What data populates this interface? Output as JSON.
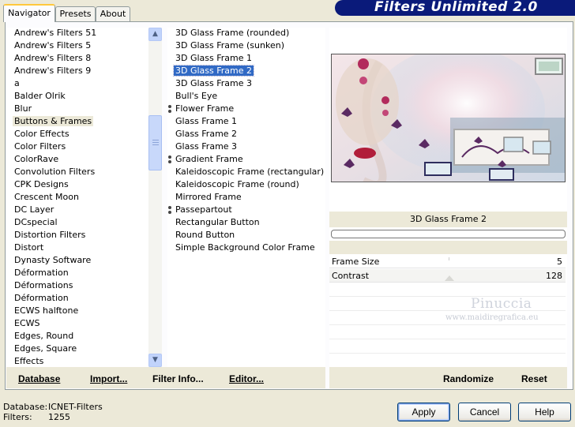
{
  "tabs": [
    {
      "label": "Navigator"
    },
    {
      "label": "Presets"
    },
    {
      "label": "About"
    }
  ],
  "brand": {
    "title": "Filters Unlimited 2.0",
    "color": "#0a1a7a"
  },
  "categories": {
    "selected_index": 8,
    "items": [
      "Andrew's Filters 51",
      "Andrew's Filters 5",
      "Andrew's Filters 8",
      "Andrew's Filters 9",
      "a",
      "Balder Olrik",
      "Blur",
      "Buttons & Frames",
      "Color Effects",
      "Color Filters",
      "ColorRave",
      "Convolution Filters",
      "CPK Designs",
      "Crescent Moon",
      "DC Layer",
      "DCspecial",
      "Distortion Filters",
      "Distort",
      "Dynasty Software",
      "Déformation",
      "Déformations",
      "Déformation",
      "ECWS halftone",
      "ECWS",
      "Edges, Round",
      "Edges, Square",
      "Effects"
    ]
  },
  "filters": {
    "items": [
      {
        "label": "3D Glass Frame (rounded)",
        "group": false,
        "selected": false
      },
      {
        "label": "3D Glass Frame (sunken)",
        "group": false,
        "selected": false
      },
      {
        "label": "3D Glass Frame 1",
        "group": false,
        "selected": false
      },
      {
        "label": "3D Glass Frame 2",
        "group": false,
        "selected": true
      },
      {
        "label": "3D Glass Frame 3",
        "group": false,
        "selected": false
      },
      {
        "label": "Bull's Eye",
        "group": false,
        "selected": false
      },
      {
        "label": "Flower Frame",
        "group": true,
        "selected": false
      },
      {
        "label": "Glass Frame 1",
        "group": false,
        "selected": false
      },
      {
        "label": "Glass Frame 2",
        "group": false,
        "selected": false
      },
      {
        "label": "Glass Frame 3",
        "group": false,
        "selected": false
      },
      {
        "label": "Gradient Frame",
        "group": true,
        "selected": false
      },
      {
        "label": "Kaleidoscopic Frame (rectangular)",
        "group": false,
        "selected": false
      },
      {
        "label": "Kaleidoscopic Frame (round)",
        "group": false,
        "selected": false
      },
      {
        "label": "Mirrored Frame",
        "group": false,
        "selected": false
      },
      {
        "label": "Passepartout",
        "group": true,
        "selected": false
      },
      {
        "label": "Rectangular Button",
        "group": false,
        "selected": false
      },
      {
        "label": "Round Button",
        "group": false,
        "selected": false
      },
      {
        "label": "Simple Background Color Frame",
        "group": false,
        "selected": false
      }
    ]
  },
  "toolbar": {
    "database": "Database",
    "import": "Import...",
    "filter_info": "Filter Info...",
    "editor": "Editor...",
    "randomize": "Randomize",
    "reset": "Reset"
  },
  "preview": {
    "filter_name": "3D Glass Frame 2",
    "watermark_name": "Pinuccia",
    "watermark_url": "www.maidiregrafica.eu"
  },
  "controls": [
    {
      "label": "Frame Size",
      "value": "5"
    },
    {
      "label": "Contrast",
      "value": "128"
    }
  ],
  "status": {
    "database_label": "Database:",
    "database_value": "ICNET-Filters",
    "filters_label": "Filters:",
    "filters_value": "1255"
  },
  "dialog_buttons": {
    "apply": "Apply",
    "cancel": "Cancel",
    "help": "Help"
  }
}
